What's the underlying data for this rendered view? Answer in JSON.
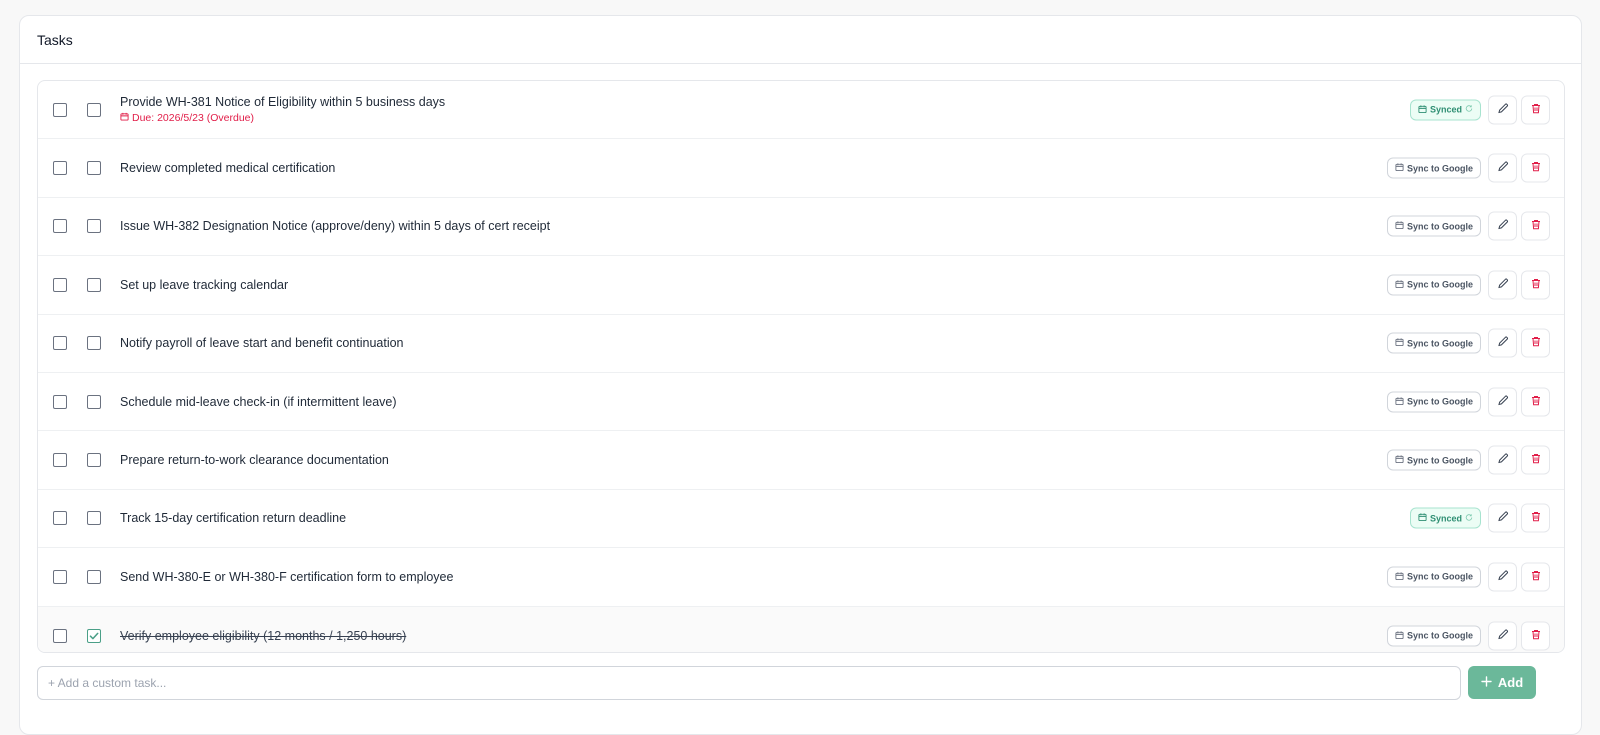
{
  "card": {
    "title": "Tasks"
  },
  "tasks": [
    {
      "text": "Provide WH-381 Notice of Eligibility within 5 business days",
      "due": "Due: 2026/5/23 (Overdue)",
      "sync_label": "Synced",
      "synced": true,
      "completed": false
    },
    {
      "text": "Review completed medical certification",
      "due": "",
      "sync_label": "Sync to Google",
      "synced": false,
      "completed": false
    },
    {
      "text": "Issue WH-382 Designation Notice (approve/deny) within 5 days of cert receipt",
      "due": "",
      "sync_label": "Sync to Google",
      "synced": false,
      "completed": false
    },
    {
      "text": "Set up leave tracking calendar",
      "due": "",
      "sync_label": "Sync to Google",
      "synced": false,
      "completed": false
    },
    {
      "text": "Notify payroll of leave start and benefit continuation",
      "due": "",
      "sync_label": "Sync to Google",
      "synced": false,
      "completed": false
    },
    {
      "text": "Schedule mid-leave check-in (if intermittent leave)",
      "due": "",
      "sync_label": "Sync to Google",
      "synced": false,
      "completed": false
    },
    {
      "text": "Prepare return-to-work clearance documentation",
      "due": "",
      "sync_label": "Sync to Google",
      "synced": false,
      "completed": false
    },
    {
      "text": "Track 15-day certification return deadline",
      "due": "",
      "sync_label": "Synced",
      "synced": true,
      "completed": false
    },
    {
      "text": "Send WH-380-E or WH-380-F certification form to employee",
      "due": "",
      "sync_label": "Sync to Google",
      "synced": false,
      "completed": false
    },
    {
      "text": "Verify employee eligibility (12 months / 1,250 hours)",
      "due": "",
      "sync_label": "Sync to Google",
      "synced": false,
      "completed": true
    }
  ],
  "add_task": {
    "placeholder": "+ Add a custom task...",
    "button_label": "Add"
  },
  "icons": {
    "calendar": "calendar-icon",
    "refresh": "refresh-icon",
    "edit": "pencil-icon",
    "delete": "trash-icon",
    "check": "check-icon",
    "plus": "plus-icon"
  },
  "colors": {
    "accent": "#6bb89a",
    "synced_bg": "#ecfdf5",
    "synced_text": "#2f8f73",
    "overdue": "#e11d48",
    "delete": "#e11d48"
  }
}
